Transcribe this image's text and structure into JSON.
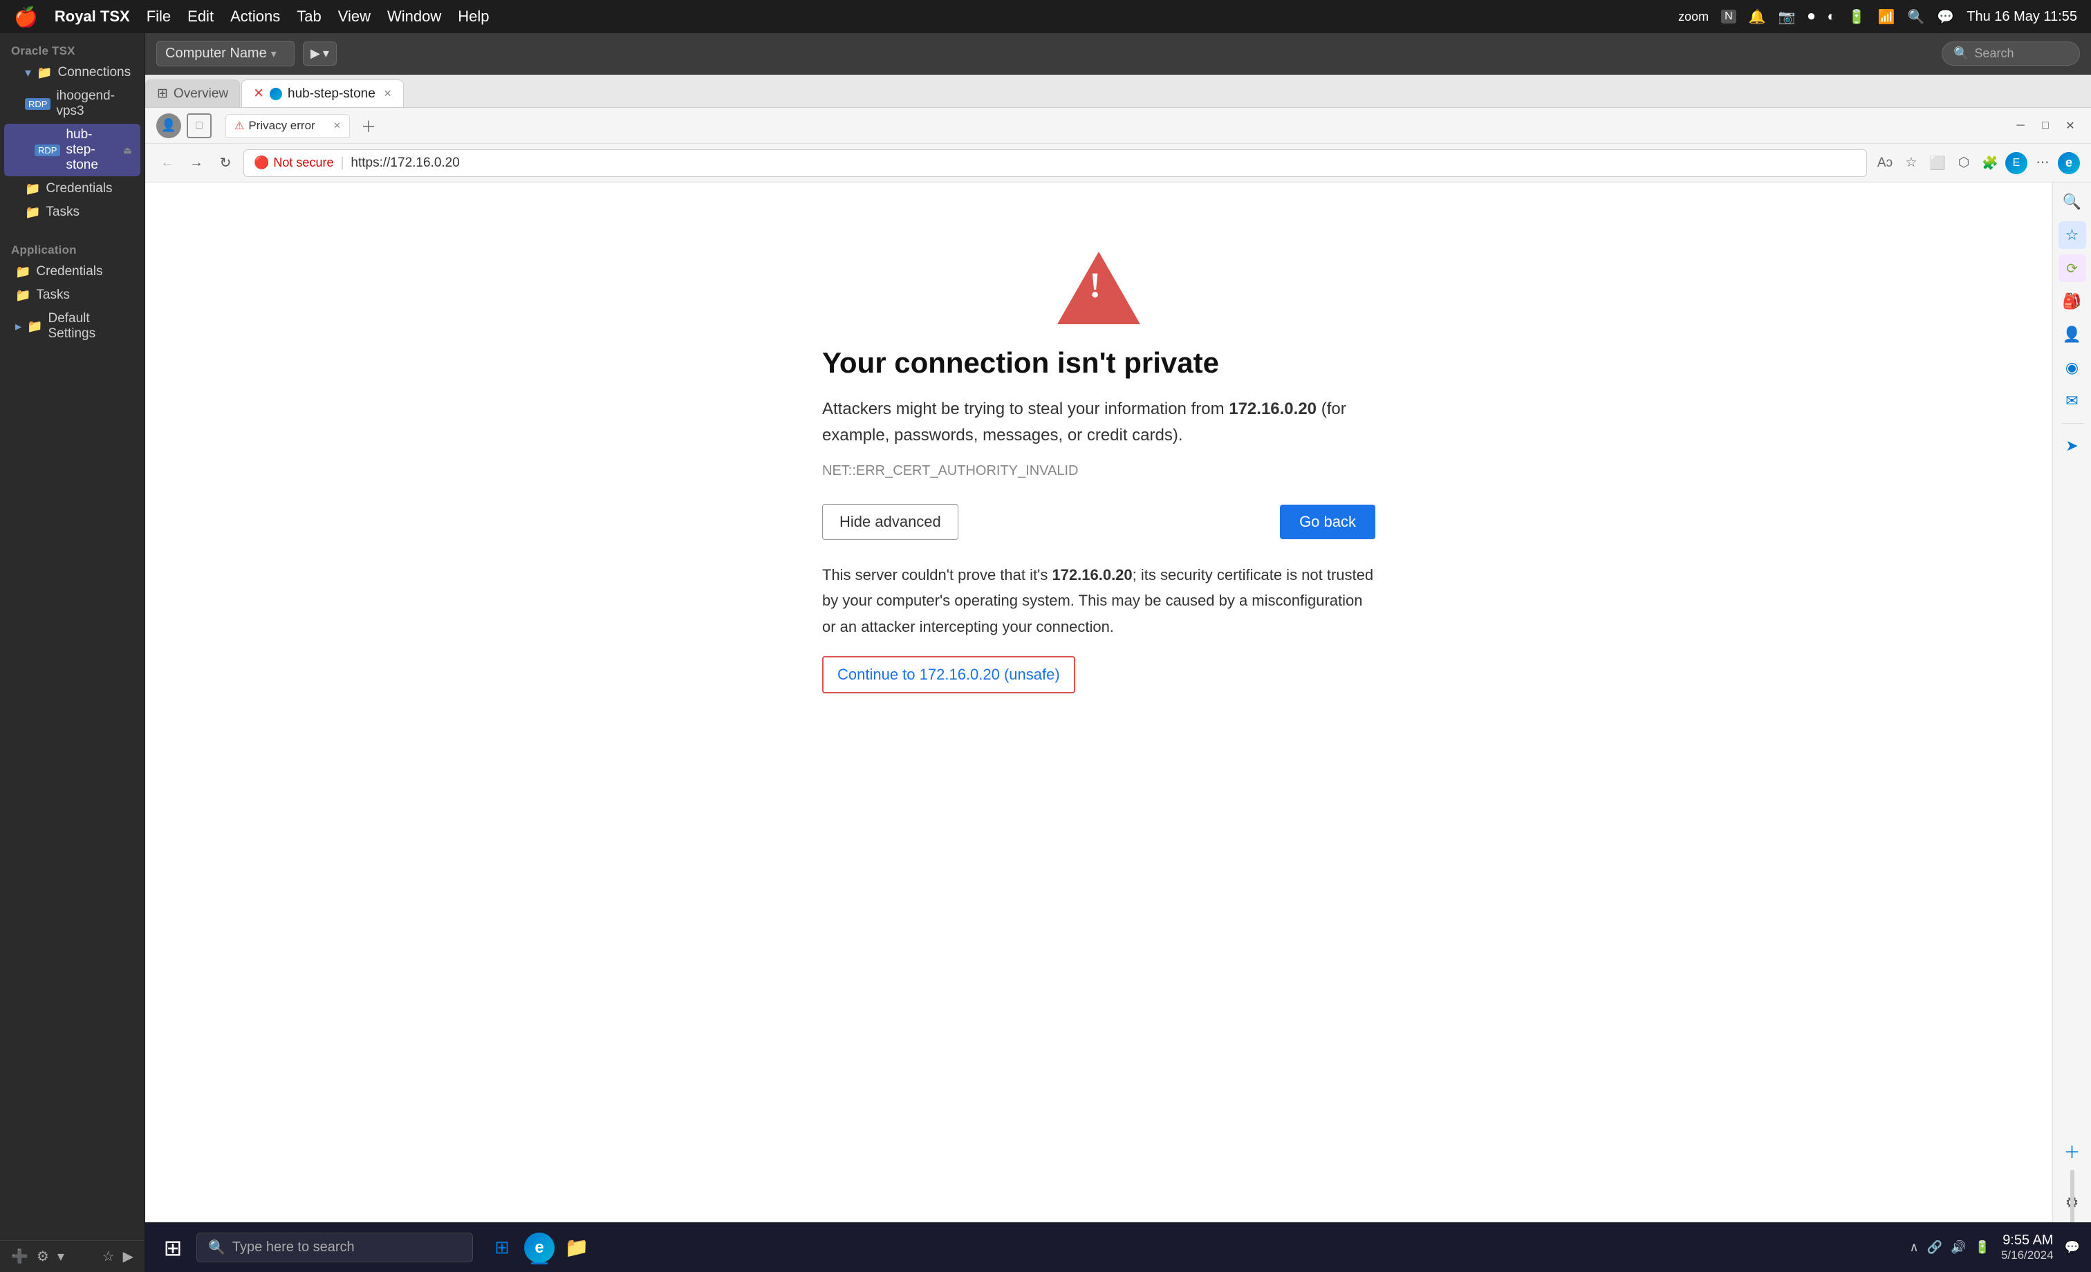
{
  "menubar": {
    "apple": "🍎",
    "app_name": "Royal TSX",
    "menus": [
      "File",
      "Edit",
      "Actions",
      "Tab",
      "View",
      "Window",
      "Help"
    ],
    "right_items": [
      "zoom",
      "N",
      "🔔",
      "📷",
      "⏺",
      "◐",
      "🔋",
      "📶",
      "🔍",
      "💬"
    ],
    "time": "Thu 16 May  11:55"
  },
  "sidebar": {
    "oracle_label": "Oracle TSX",
    "connections_label": "Connections",
    "items": [
      {
        "label": "ihoogend-vps3",
        "type": "rdp",
        "indent": 1
      },
      {
        "label": "hub-step-stone",
        "type": "rdp",
        "indent": 2,
        "active": true
      },
      {
        "label": "Credentials",
        "type": "folder",
        "indent": 1
      },
      {
        "label": "Tasks",
        "type": "folder",
        "indent": 1
      }
    ],
    "application_label": "Application",
    "app_items": [
      {
        "label": "Credentials",
        "type": "folder"
      },
      {
        "label": "Tasks",
        "type": "folder"
      },
      {
        "label": "Default Settings",
        "type": "folder"
      }
    ]
  },
  "topbar": {
    "computer_name": "Computer Name",
    "search_placeholder": "Search"
  },
  "tabs": {
    "overview_label": "Overview",
    "active_tab_label": "hub-step-stone"
  },
  "browser": {
    "tab_title": "Privacy error",
    "title_bar_label": "Privacy error",
    "url": "https://172.16.0.20",
    "not_secure_label": "Not secure",
    "error": {
      "title": "Your connection isn't private",
      "desc_before": "Attackers might be trying to steal your information from ",
      "desc_ip": "172.16.0.20",
      "desc_after": " (for example, passwords, messages, or credit cards).",
      "error_code": "NET::ERR_CERT_AUTHORITY_INVALID",
      "hide_advanced_btn": "Hide advanced",
      "go_back_btn": "Go back",
      "advanced_text_before": "This server couldn't prove that it's ",
      "advanced_ip": "172.16.0.20",
      "advanced_text_after": "; its security certificate is not trusted by your computer's operating system. This may be caused by a misconfiguration or an attacker intercepting your connection.",
      "continue_link": "Continue to 172.16.0.20 (unsafe)"
    }
  },
  "taskbar": {
    "search_placeholder": "Type here to search",
    "time": "9:55 AM",
    "date": "5/16/2024"
  }
}
